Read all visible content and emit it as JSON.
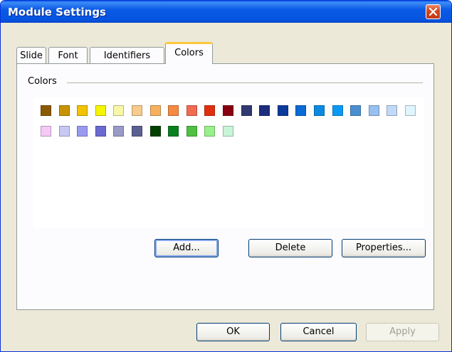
{
  "window": {
    "title": "Module Settings"
  },
  "tabs": [
    {
      "label": "Slide",
      "active": false
    },
    {
      "label": "Font",
      "active": false
    },
    {
      "label": "Identifiers",
      "active": false
    },
    {
      "label": "Colors",
      "active": true
    }
  ],
  "panel": {
    "group_label": "Colors",
    "swatches_row1": [
      "#8b5a00",
      "#c89300",
      "#f2c300",
      "#f5f500",
      "#f7f7a8",
      "#f7cc8c",
      "#f7b060",
      "#f58a40",
      "#f26a50",
      "#e03010",
      "#880010",
      "#303a70",
      "#1c2d80",
      "#0a3a9a",
      "#0a6ad6",
      "#0a8ae0",
      "#0a9af5",
      "#4a90d0",
      "#98c0f0",
      "#c0daf7",
      "#e0f5fd"
    ],
    "swatches_row2": [
      "#f5c8f5",
      "#c8c8f5",
      "#9a9af0",
      "#6a6ad0",
      "#9a9ac8",
      "#5a6090",
      "#004000",
      "#0a8020",
      "#50c040",
      "#98f088",
      "#c8f5d8"
    ],
    "buttons": {
      "add": "Add...",
      "delete": "Delete",
      "properties": "Properties..."
    }
  },
  "footer": {
    "ok": "OK",
    "cancel": "Cancel",
    "apply": "Apply"
  }
}
